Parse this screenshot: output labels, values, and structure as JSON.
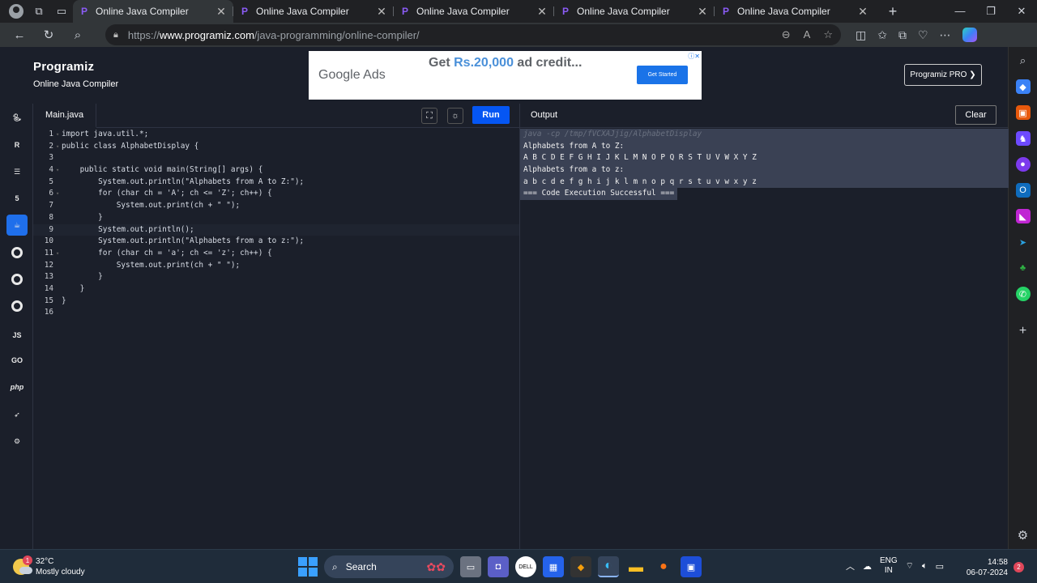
{
  "browser": {
    "tabs": [
      {
        "title": "Online Java Compiler",
        "active": true
      },
      {
        "title": "Online Java Compiler",
        "active": false
      },
      {
        "title": "Online Java Compiler",
        "active": false
      },
      {
        "title": "Online Java Compiler",
        "active": false
      },
      {
        "title": "Online Java Compiler",
        "active": false
      }
    ],
    "url_proto": "https://",
    "url_host": "www.programiz.com",
    "url_path": "/java-programming/online-compiler/"
  },
  "header": {
    "logo": "Programiz",
    "subtitle": "Online Java Compiler",
    "pro_button": "Programiz PRO ❯"
  },
  "ad": {
    "brand": "Google Ads",
    "headline_prefix": "Get ",
    "headline_amount": "Rs.20,000",
    "headline_suffix": " ad credit...",
    "cta": "Get Started"
  },
  "editor": {
    "file_tab": "Main.java",
    "run_label": "Run",
    "lines": [
      "import java.util.*;",
      "public class AlphabetDisplay {",
      "",
      "    public static void main(String[] args) {",
      "        System.out.println(\"Alphabets from A to Z:\");",
      "        for (char ch = 'A'; ch <= 'Z'; ch++) {",
      "            System.out.print(ch + \" \");",
      "        }",
      "        System.out.println();",
      "        System.out.println(\"Alphabets from a to z:\");",
      "        for (char ch = 'a'; ch <= 'z'; ch++) {",
      "            System.out.print(ch + \" \");",
      "        }",
      "    }",
      "}",
      ""
    ],
    "line_numbers": [
      "1",
      "2",
      "3",
      "4",
      "5",
      "6",
      "7",
      "8",
      "9",
      "10",
      "11",
      "12",
      "13",
      "14",
      "15",
      "16"
    ],
    "current_line": 9
  },
  "output": {
    "title": "Output",
    "clear_label": "Clear",
    "command": "java -cp /tmp/fVCXAJjig/AlphabetDisplay",
    "lines": [
      "Alphabets from A to Z:",
      "A B C D E F G H I J K L M N O P Q R S T U V W X Y Z",
      "Alphabets from a to z:",
      "a b c d e f g h i j k l m n o p q r s t u v w x y z"
    ],
    "status": "=== Code Execution Successful ==="
  },
  "languages": [
    "python",
    "r",
    "sql",
    "html",
    "java",
    "c",
    "c++",
    "c#",
    "JS",
    "GO",
    "php",
    "swift",
    "rust"
  ],
  "taskbar": {
    "weather_temp": "32°C",
    "weather_desc": "Mostly cloudy",
    "weather_badge": "1",
    "search_label": "Search",
    "lang_line1": "ENG",
    "lang_line2": "IN",
    "time": "14:58",
    "date": "06-07-2024",
    "notif_count": "2"
  }
}
